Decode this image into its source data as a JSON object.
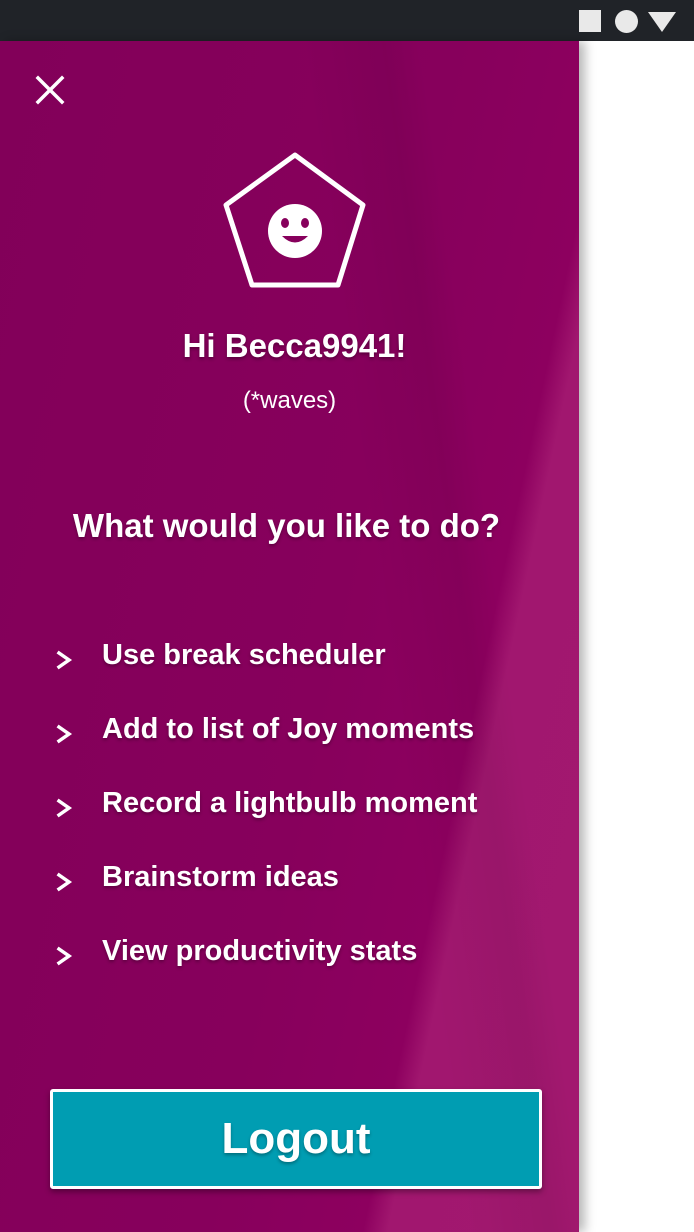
{
  "status_bar": {
    "icons": [
      "square-icon",
      "circle-icon",
      "triangle-down-icon"
    ],
    "background": "#202328",
    "icon_color": "#e9e9e9"
  },
  "drawer": {
    "background": "#87005c",
    "close_icon": "close-icon",
    "avatar_icon": "pentagon-smiley-icon",
    "greeting": "Hi Becca9941!",
    "subgreeting": "(*waves)",
    "question": "What would you like to do?",
    "menu_items": [
      {
        "label": "Use break scheduler",
        "icon": "chevron-right-icon"
      },
      {
        "label": "Add to list of Joy moments",
        "icon": "chevron-right-icon"
      },
      {
        "label": "Record a lightbulb moment",
        "icon": "chevron-right-icon"
      },
      {
        "label": "Brainstorm ideas",
        "icon": "chevron-right-icon"
      },
      {
        "label": "View productivity stats",
        "icon": "chevron-right-icon"
      }
    ],
    "logout_label": "Logout",
    "logout_color": "#009db2"
  }
}
